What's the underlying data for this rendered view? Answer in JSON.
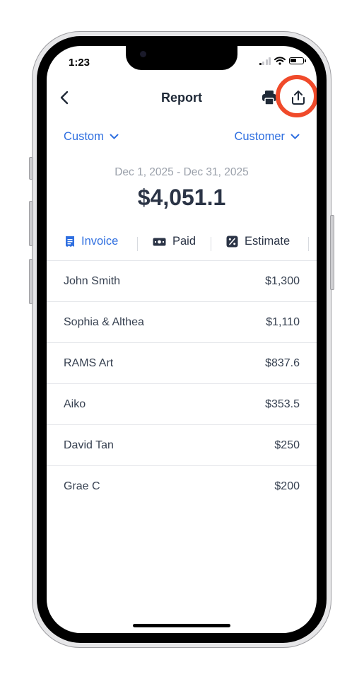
{
  "status_bar": {
    "time": "1:23"
  },
  "header": {
    "title": "Report"
  },
  "filters": {
    "period": "Custom",
    "group_by": "Customer"
  },
  "summary": {
    "date_range": "Dec 1, 2025 - Dec 31, 2025",
    "total": "$4,051.1"
  },
  "tabs": [
    {
      "label": "Invoice",
      "icon": "invoice-list-icon",
      "active": true
    },
    {
      "label": "Paid",
      "icon": "cash-icon",
      "active": false
    },
    {
      "label": "Estimate",
      "icon": "percent-icon",
      "active": false
    }
  ],
  "rows": [
    {
      "name": "John Smith",
      "amount": "$1,300"
    },
    {
      "name": "Sophia & Althea",
      "amount": "$1,110"
    },
    {
      "name": "RAMS Art",
      "amount": "$837.6"
    },
    {
      "name": "Aiko",
      "amount": "$353.5"
    },
    {
      "name": "David Tan",
      "amount": "$250"
    },
    {
      "name": "Grae C",
      "amount": "$200"
    }
  ],
  "colors": {
    "accent": "#2f6fe0",
    "highlight": "#f04a2a",
    "text": "#2b3446",
    "muted": "#9aa0aa"
  }
}
